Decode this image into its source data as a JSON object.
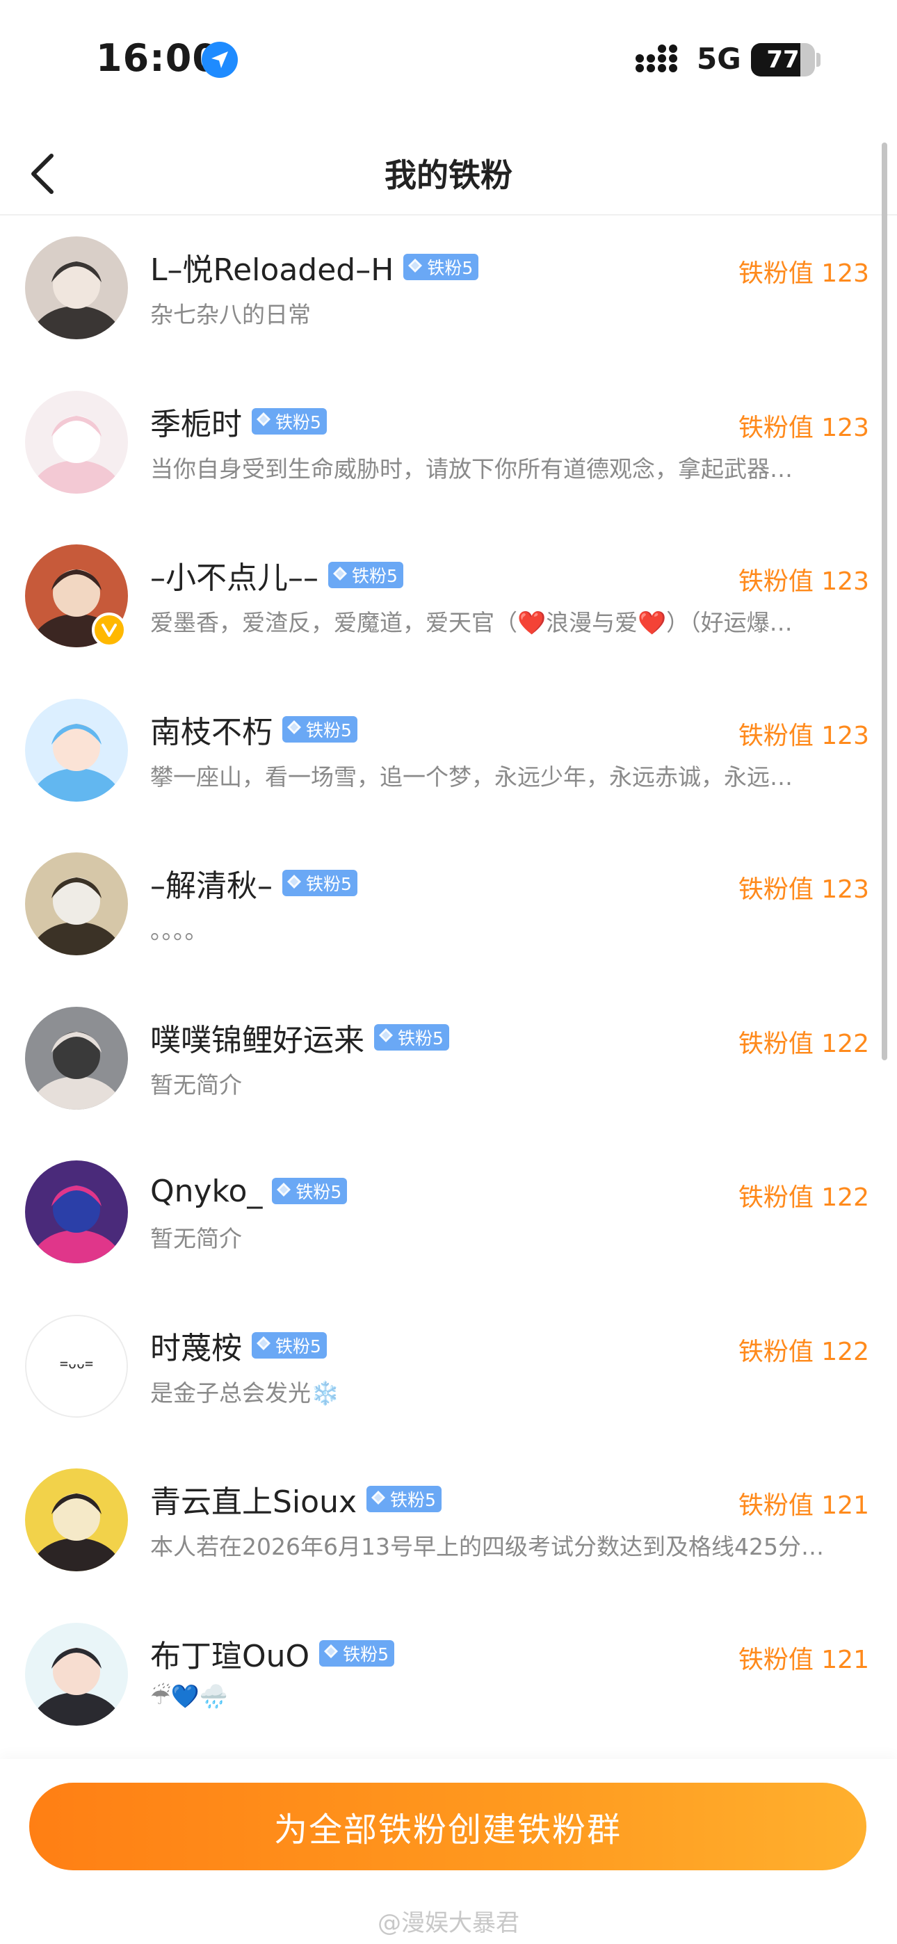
{
  "status_bar": {
    "time": "16:00",
    "network": "5G",
    "battery": "77",
    "battery_level": 0.77
  },
  "nav": {
    "title": "我的铁粉",
    "back_icon": "chevron-left-icon"
  },
  "fans": [
    {
      "name": "L–悦Reloaded–H",
      "badge": "铁粉5",
      "value_label": "铁粉值 123",
      "bio": "杂七杂八的日常"
    },
    {
      "name": "季栀时",
      "badge": "铁粉5",
      "value_label": "铁粉值 123",
      "bio": "当你自身受到生命威胁时，请放下你所有道德观念，拿起武器…"
    },
    {
      "name": "–小不点儿––",
      "badge": "铁粉5",
      "value_label": "铁粉值 123",
      "bio": "爱墨香，爱渣反，爱魔道，爱天官（❤️浪漫与爱❤️）（好运爆…",
      "verified": true
    },
    {
      "name": "南枝不朽",
      "badge": "铁粉5",
      "value_label": "铁粉值 123",
      "bio": "攀一座山，看一场雪，追一个梦，永远少年，永远赤诚，永远…"
    },
    {
      "name": "–解清秋–",
      "badge": "铁粉5",
      "value_label": "铁粉值 123",
      "bio": "。。。。"
    },
    {
      "name": "噗噗锦鲤好运来",
      "badge": "铁粉5",
      "value_label": "铁粉值 122",
      "bio": "暂无简介"
    },
    {
      "name": "Qnyko_",
      "badge": "铁粉5",
      "value_label": "铁粉值 122",
      "bio": "暂无简介"
    },
    {
      "name": "时蔑桉",
      "badge": "铁粉5",
      "value_label": "铁粉值 122",
      "bio": "是金子总会发光❄️",
      "avatar_text": "=ᴗᴗ="
    },
    {
      "name": "青云直上Sioux",
      "badge": "铁粉5",
      "value_label": "铁粉值 121",
      "bio": "本人若在2026年6月13号早上的四级考试分数达到及格线425分…"
    },
    {
      "name": "布丁瑄OuO",
      "badge": "铁粉5",
      "value_label": "铁粉值 121",
      "bio": "☔💙🌧️"
    }
  ],
  "bottom": {
    "button_label": "为全部铁粉创建铁粉群",
    "watermark": "@漫娱大暴君"
  },
  "colors": {
    "accent": "#ff8a1c",
    "badge": "#6aa8f5",
    "button_start": "#ff7f14",
    "button_end": "#ffb02e"
  }
}
